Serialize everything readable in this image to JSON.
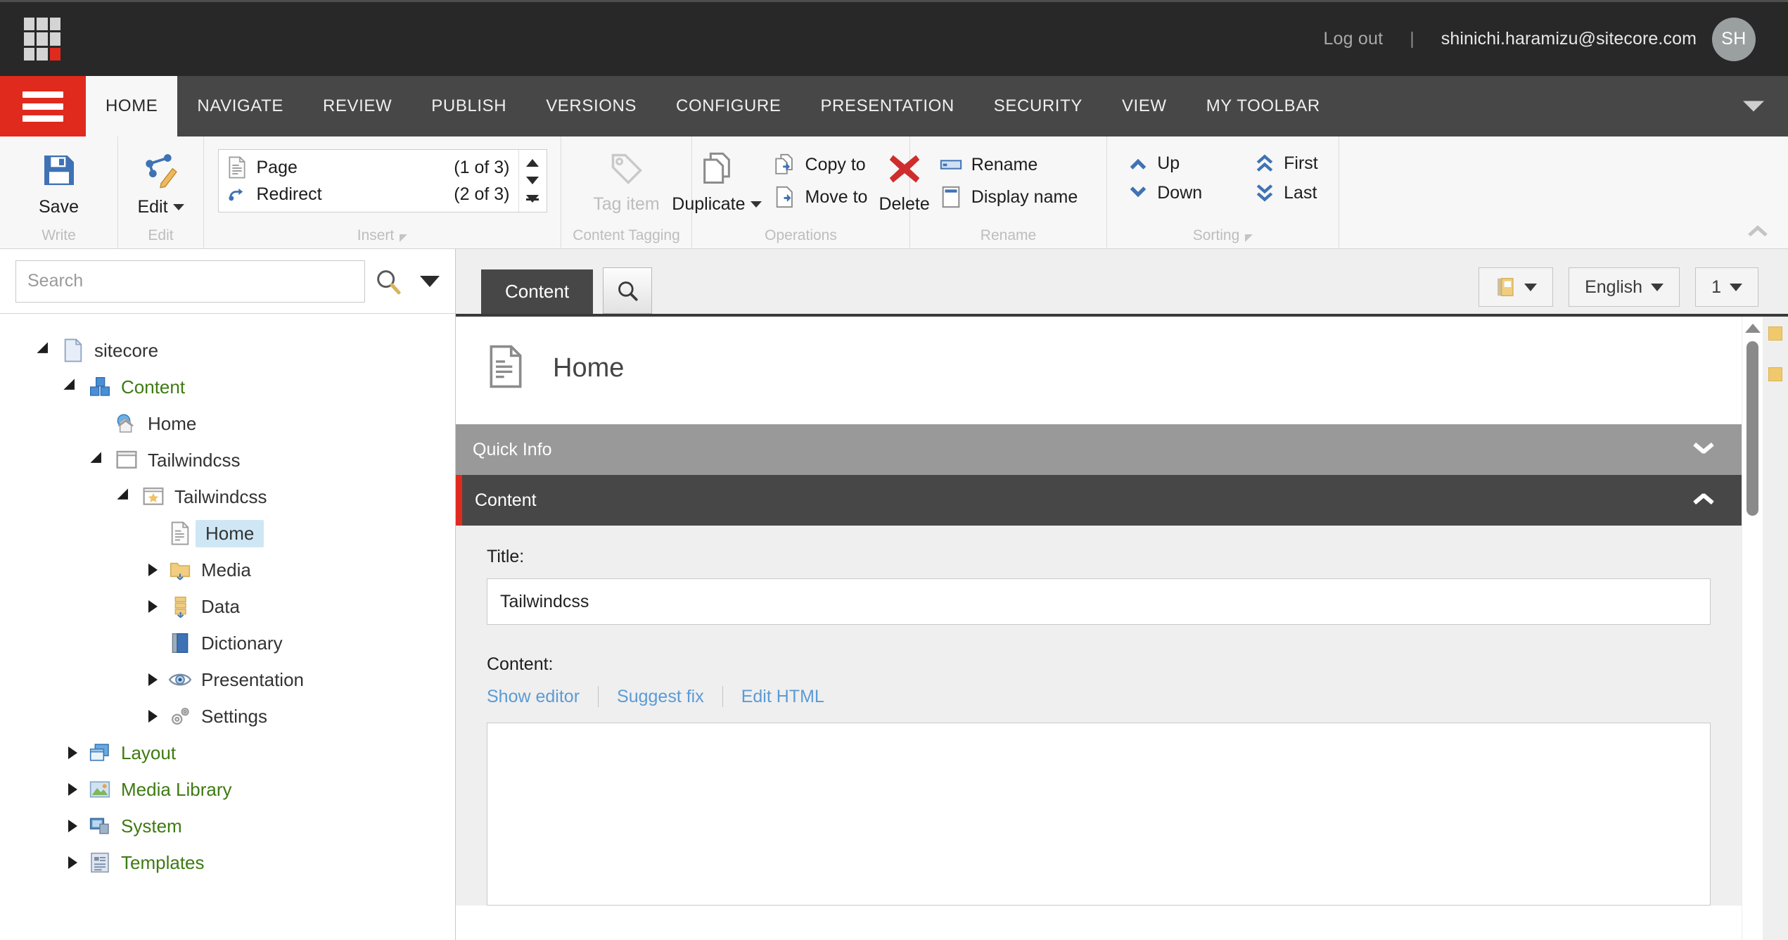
{
  "topbar": {
    "logo_name": "sitecore-logo",
    "logout_label": "Log out",
    "separator": "|",
    "user_email": "shinichi.haramizu@sitecore.com",
    "avatar_initials": "SH"
  },
  "ribbon": {
    "tabs": [
      {
        "label": "HOME",
        "active": true
      },
      {
        "label": "NAVIGATE",
        "active": false
      },
      {
        "label": "REVIEW",
        "active": false
      },
      {
        "label": "PUBLISH",
        "active": false
      },
      {
        "label": "VERSIONS",
        "active": false
      },
      {
        "label": "CONFIGURE",
        "active": false
      },
      {
        "label": "PRESENTATION",
        "active": false
      },
      {
        "label": "SECURITY",
        "active": false
      },
      {
        "label": "VIEW",
        "active": false
      },
      {
        "label": "MY TOOLBAR",
        "active": false
      }
    ],
    "groups": {
      "write": {
        "title": "Write",
        "save_label": "Save"
      },
      "edit": {
        "title": "Edit",
        "edit_label": "Edit"
      },
      "insert": {
        "title": "Insert",
        "rows": [
          {
            "label": "Page",
            "count": "(1 of 3)"
          },
          {
            "label": "Redirect",
            "count": "(2 of 3)"
          }
        ]
      },
      "content_tagging": {
        "title": "Content Tagging",
        "tag_item_label": "Tag item"
      },
      "operations": {
        "title": "Operations",
        "duplicate_label": "Duplicate",
        "copy_to_label": "Copy to",
        "move_to_label": "Move to",
        "delete_label": "Delete"
      },
      "rename": {
        "title": "Rename",
        "rename_label": "Rename",
        "display_name_label": "Display name"
      },
      "sorting": {
        "title": "Sorting",
        "up_label": "Up",
        "down_label": "Down",
        "first_label": "First",
        "last_label": "Last"
      }
    }
  },
  "sidebar": {
    "search_placeholder": "Search",
    "search_value": "",
    "tree": [
      {
        "label": "sitecore",
        "depth": 0,
        "twist": "open",
        "icon": "document-icon",
        "green": false,
        "selected": false
      },
      {
        "label": "Content",
        "depth": 1,
        "twist": "open",
        "icon": "content-cubes-icon",
        "green": true,
        "selected": false
      },
      {
        "label": "Home",
        "depth": 2,
        "twist": "none",
        "icon": "home-globe-icon",
        "green": false,
        "selected": false
      },
      {
        "label": "Tailwindcss",
        "depth": 2,
        "twist": "open",
        "icon": "site-window-icon",
        "green": false,
        "selected": false
      },
      {
        "label": "Tailwindcss",
        "depth": 3,
        "twist": "open",
        "icon": "star-window-icon",
        "green": false,
        "selected": false
      },
      {
        "label": "Home",
        "depth": 4,
        "twist": "none",
        "icon": "page-icon",
        "green": false,
        "selected": true
      },
      {
        "label": "Media",
        "depth": 4,
        "twist": "closed",
        "icon": "media-folder-icon",
        "green": false,
        "selected": false
      },
      {
        "label": "Data",
        "depth": 4,
        "twist": "closed",
        "icon": "data-icon",
        "green": false,
        "selected": false
      },
      {
        "label": "Dictionary",
        "depth": 4,
        "twist": "none",
        "icon": "dictionary-book-icon",
        "green": false,
        "selected": false
      },
      {
        "label": "Presentation",
        "depth": 4,
        "twist": "closed",
        "icon": "eye-icon",
        "green": false,
        "selected": false
      },
      {
        "label": "Settings",
        "depth": 4,
        "twist": "closed",
        "icon": "gears-icon",
        "green": false,
        "selected": false
      },
      {
        "label": "Layout",
        "depth": 1,
        "twist": "closed",
        "icon": "layout-windows-icon",
        "green": true,
        "selected": false
      },
      {
        "label": "Media Library",
        "depth": 1,
        "twist": "closed",
        "icon": "media-library-icon",
        "green": true,
        "selected": false
      },
      {
        "label": "System",
        "depth": 1,
        "twist": "closed",
        "icon": "system-icon",
        "green": true,
        "selected": false
      },
      {
        "label": "Templates",
        "depth": 1,
        "twist": "closed",
        "icon": "templates-icon",
        "green": true,
        "selected": false
      }
    ]
  },
  "content": {
    "tabs": [
      {
        "label": "Content",
        "active": true
      }
    ],
    "search_tab_icon": "search-icon",
    "toolbar_right": {
      "workflow_value": "",
      "language_value": "English",
      "version_value": "1"
    },
    "item_title": "Home",
    "item_icon": "page-icon",
    "sections": [
      {
        "label": "Quick Info",
        "state": "collapsed"
      },
      {
        "label": "Content",
        "state": "expanded"
      }
    ],
    "fields": {
      "title_label": "Title:",
      "title_value": "Tailwindcss",
      "content_label": "Content:",
      "content_value": "",
      "links": [
        "Show editor",
        "Suggest fix",
        "Edit HTML"
      ]
    }
  },
  "colors": {
    "accent_red": "#e02a1e",
    "dark_chrome": "#282828",
    "ribbon_gray": "#474747",
    "section_gray": "#999999",
    "link_blue": "#5b9bd5",
    "tree_green": "#3e7a12",
    "marker_gold": "#efc96b"
  }
}
